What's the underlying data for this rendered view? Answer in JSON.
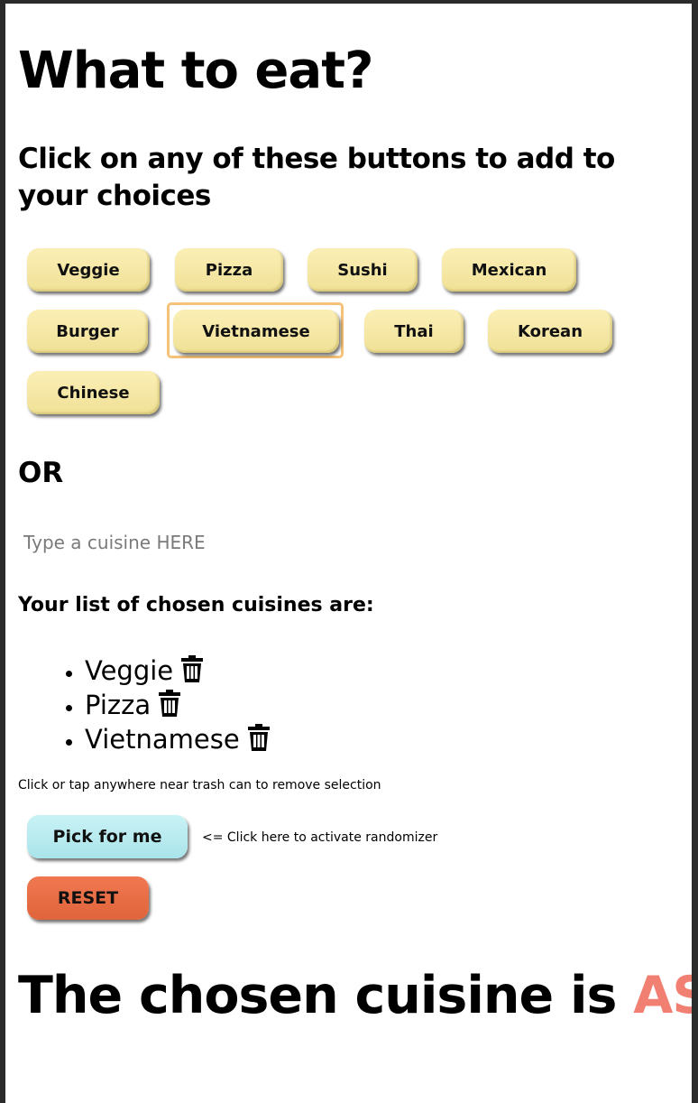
{
  "page": {
    "title": "What to eat?",
    "subtitle": "Click on any of these buttons to add to your choices",
    "or_label": "OR"
  },
  "cuisine_buttons": [
    {
      "label": "Veggie"
    },
    {
      "label": "Pizza"
    },
    {
      "label": "Sushi"
    },
    {
      "label": "Mexican"
    },
    {
      "label": "Burger"
    },
    {
      "label": "Vietnamese",
      "focused": true
    },
    {
      "label": "Thai"
    },
    {
      "label": "Korean"
    },
    {
      "label": "Chinese"
    }
  ],
  "input": {
    "placeholder": "Type a cuisine HERE",
    "value": ""
  },
  "chosen": {
    "heading": "Your list of chosen cuisines are:",
    "items": [
      "Veggie",
      "Pizza",
      "Vietnamese"
    ],
    "item_icon": "trash-icon",
    "hint": "Click or tap anywhere near trash can to remove selection"
  },
  "actions": {
    "pick_label": "Pick for me",
    "pick_hint": "<= Click here to activate randomizer",
    "reset_label": "RESET"
  },
  "result": {
    "prefix": "The chosen cuisine is ",
    "value": "ASS"
  },
  "colors": {
    "cuisine_button": "#f5e7a6",
    "pick_button": "#b8ebf0",
    "reset_button": "#e86c46",
    "result_accent": "#f28072",
    "focus_ring": "#f5c27a"
  }
}
